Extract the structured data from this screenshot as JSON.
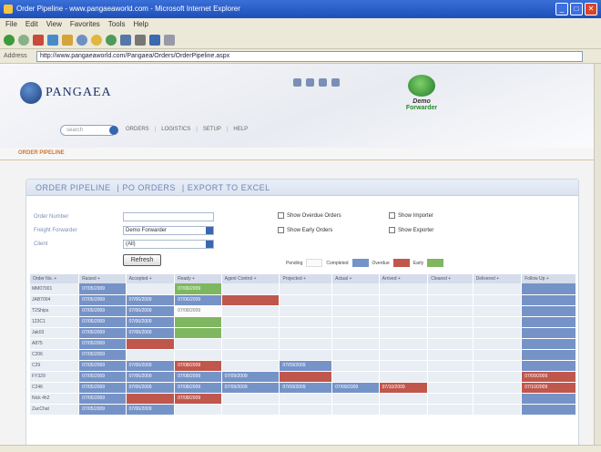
{
  "window": {
    "title": "Order Pipeline - www.pangaeaworld.com - Microsoft Internet Explorer",
    "buttons": [
      "_",
      "□",
      "✕"
    ]
  },
  "menu": [
    "File",
    "Edit",
    "View",
    "Favorites",
    "Tools",
    "Help"
  ],
  "toolbar_icons": [
    "back-icon",
    "forward-icon",
    "stop-icon",
    "refresh-icon",
    "home-icon",
    "search-icon",
    "favorites-icon",
    "history-icon",
    "mail-icon",
    "print-icon",
    "edit-icon",
    "discuss-icon"
  ],
  "address": {
    "label": "Address",
    "url": "http://www.pangaeaworld.com/Pangaea/Orders/OrderPipeline.aspx"
  },
  "header": {
    "logo_text": "PANGAEA",
    "partner_line1": "Demo",
    "partner_line2": "Forwarder",
    "search_placeholder": "search",
    "nav": [
      "ORDERS",
      "LOGISTICS",
      "SETUP",
      "HELP"
    ]
  },
  "breadcrumb": "ORDER PIPELINE",
  "panel": {
    "tabs": [
      "ORDER PIPELINE",
      "PO ORDERS",
      "EXPORT TO EXCEL"
    ],
    "filters": {
      "order_number_label": "Order Number",
      "order_number_value": "",
      "forwarder_label": "Freight Forwarder",
      "forwarder_value": "Demo Forwarder",
      "client_label": "Client",
      "client_value": "(All)"
    },
    "checkboxes": [
      "Show Overdue Orders",
      "Show Importer",
      "Show Early Orders",
      "Show Exporter"
    ],
    "refresh_label": "Refresh",
    "legend": [
      {
        "label": "Pending",
        "color": "#fafafa"
      },
      {
        "label": "Completed",
        "color": "#7693c8"
      },
      {
        "label": "Overdue",
        "color": "#c0574c"
      },
      {
        "label": "Early",
        "color": "#7fb760"
      }
    ]
  },
  "grid": {
    "headers": [
      "Order No. +",
      "Raised +",
      "Accepted +",
      "Ready +",
      "Agent Control +",
      "Projected +",
      "Actual +",
      "Arrived +",
      "Cleared +",
      "Delivered +",
      "Follow Up +"
    ],
    "rows": [
      {
        "id": "MM07001",
        "cells": [
          {
            "s": "bl",
            "t": "07/05/2009"
          },
          {
            "s": "",
            "t": ""
          },
          {
            "s": "gr",
            "t": "07/06/2009"
          },
          {
            "s": "",
            "t": ""
          },
          {
            "s": "",
            "t": ""
          },
          {
            "s": "",
            "t": ""
          },
          {
            "s": "",
            "t": ""
          },
          {
            "s": "",
            "t": ""
          },
          {
            "s": "",
            "t": ""
          },
          {
            "s": "bl",
            "t": ""
          }
        ]
      },
      {
        "id": "JAB7004",
        "cells": [
          {
            "s": "bl",
            "t": "07/05/2009"
          },
          {
            "s": "bl",
            "t": "07/06/2009"
          },
          {
            "s": "bl",
            "t": "07/06/2009"
          },
          {
            "s": "rd",
            "t": ""
          },
          {
            "s": "",
            "t": ""
          },
          {
            "s": "",
            "t": ""
          },
          {
            "s": "",
            "t": ""
          },
          {
            "s": "",
            "t": ""
          },
          {
            "s": "",
            "t": ""
          },
          {
            "s": "bl",
            "t": ""
          }
        ]
      },
      {
        "id": "T2Ships",
        "cells": [
          {
            "s": "bl",
            "t": "07/05/2009"
          },
          {
            "s": "bl",
            "t": "07/06/2009"
          },
          {
            "s": "pd",
            "t": "07/08/2009"
          },
          {
            "s": "",
            "t": ""
          },
          {
            "s": "",
            "t": ""
          },
          {
            "s": "",
            "t": ""
          },
          {
            "s": "",
            "t": ""
          },
          {
            "s": "",
            "t": ""
          },
          {
            "s": "",
            "t": ""
          },
          {
            "s": "bl",
            "t": ""
          }
        ]
      },
      {
        "id": "123C1",
        "cells": [
          {
            "s": "bl",
            "t": "07/05/2009"
          },
          {
            "s": "bl",
            "t": "07/06/2009"
          },
          {
            "s": "gr",
            "t": ""
          },
          {
            "s": "",
            "t": ""
          },
          {
            "s": "",
            "t": ""
          },
          {
            "s": "",
            "t": ""
          },
          {
            "s": "",
            "t": ""
          },
          {
            "s": "",
            "t": ""
          },
          {
            "s": "",
            "t": ""
          },
          {
            "s": "bl",
            "t": ""
          }
        ]
      },
      {
        "id": "Jak03",
        "cells": [
          {
            "s": "bl",
            "t": "07/05/2009"
          },
          {
            "s": "bl",
            "t": "07/06/2009"
          },
          {
            "s": "gr",
            "t": ""
          },
          {
            "s": "",
            "t": ""
          },
          {
            "s": "",
            "t": ""
          },
          {
            "s": "",
            "t": ""
          },
          {
            "s": "",
            "t": ""
          },
          {
            "s": "",
            "t": ""
          },
          {
            "s": "",
            "t": ""
          },
          {
            "s": "bl",
            "t": ""
          }
        ]
      },
      {
        "id": "A875",
        "cells": [
          {
            "s": "bl",
            "t": "07/05/2009"
          },
          {
            "s": "rd",
            "t": ""
          },
          {
            "s": "",
            "t": ""
          },
          {
            "s": "",
            "t": ""
          },
          {
            "s": "",
            "t": ""
          },
          {
            "s": "",
            "t": ""
          },
          {
            "s": "",
            "t": ""
          },
          {
            "s": "",
            "t": ""
          },
          {
            "s": "",
            "t": ""
          },
          {
            "s": "bl",
            "t": ""
          }
        ]
      },
      {
        "id": "C206",
        "cells": [
          {
            "s": "bl",
            "t": "07/05/2009"
          },
          {
            "s": "",
            "t": ""
          },
          {
            "s": "",
            "t": ""
          },
          {
            "s": "",
            "t": ""
          },
          {
            "s": "",
            "t": ""
          },
          {
            "s": "",
            "t": ""
          },
          {
            "s": "",
            "t": ""
          },
          {
            "s": "",
            "t": ""
          },
          {
            "s": "",
            "t": ""
          },
          {
            "s": "bl",
            "t": ""
          }
        ]
      },
      {
        "id": "C29",
        "cells": [
          {
            "s": "bl",
            "t": "07/05/2009"
          },
          {
            "s": "bl",
            "t": "07/06/2009"
          },
          {
            "s": "rd",
            "t": "07/08/2009"
          },
          {
            "s": "",
            "t": ""
          },
          {
            "s": "bl",
            "t": "07/09/2009"
          },
          {
            "s": "",
            "t": ""
          },
          {
            "s": "",
            "t": ""
          },
          {
            "s": "",
            "t": ""
          },
          {
            "s": "",
            "t": ""
          },
          {
            "s": "bl",
            "t": ""
          }
        ]
      },
      {
        "id": "FY329",
        "cells": [
          {
            "s": "bl",
            "t": "07/05/2009"
          },
          {
            "s": "bl",
            "t": "07/06/2009"
          },
          {
            "s": "bl",
            "t": "07/08/2009"
          },
          {
            "s": "bl",
            "t": "07/09/2009"
          },
          {
            "s": "rd",
            "t": ""
          },
          {
            "s": "",
            "t": ""
          },
          {
            "s": "",
            "t": ""
          },
          {
            "s": "",
            "t": ""
          },
          {
            "s": "",
            "t": ""
          },
          {
            "s": "rd",
            "t": "07/09/2009"
          }
        ]
      },
      {
        "id": "C246",
        "cells": [
          {
            "s": "bl",
            "t": "07/05/2009"
          },
          {
            "s": "bl",
            "t": "07/06/2009"
          },
          {
            "s": "bl",
            "t": "07/08/2009"
          },
          {
            "s": "bl",
            "t": "07/09/2009"
          },
          {
            "s": "bl",
            "t": "07/09/2009"
          },
          {
            "s": "bl",
            "t": "07/09/2009"
          },
          {
            "s": "rd",
            "t": "07/10/2009"
          },
          {
            "s": "",
            "t": ""
          },
          {
            "s": "",
            "t": ""
          },
          {
            "s": "rd",
            "t": "07/10/2009"
          }
        ]
      },
      {
        "id": "Nick 4h2",
        "cells": [
          {
            "s": "bl",
            "t": "07/05/2009"
          },
          {
            "s": "rd",
            "t": ""
          },
          {
            "s": "rd",
            "t": "07/08/2009"
          },
          {
            "s": "",
            "t": ""
          },
          {
            "s": "",
            "t": ""
          },
          {
            "s": "",
            "t": ""
          },
          {
            "s": "",
            "t": ""
          },
          {
            "s": "",
            "t": ""
          },
          {
            "s": "",
            "t": ""
          },
          {
            "s": "bl",
            "t": ""
          }
        ]
      },
      {
        "id": "ZacChat",
        "cells": [
          {
            "s": "bl",
            "t": "07/05/2009"
          },
          {
            "s": "bl",
            "t": "07/06/2009"
          },
          {
            "s": "",
            "t": ""
          },
          {
            "s": "",
            "t": ""
          },
          {
            "s": "",
            "t": ""
          },
          {
            "s": "",
            "t": ""
          },
          {
            "s": "",
            "t": ""
          },
          {
            "s": "",
            "t": ""
          },
          {
            "s": "",
            "t": ""
          },
          {
            "s": "bl",
            "t": ""
          }
        ]
      }
    ]
  }
}
